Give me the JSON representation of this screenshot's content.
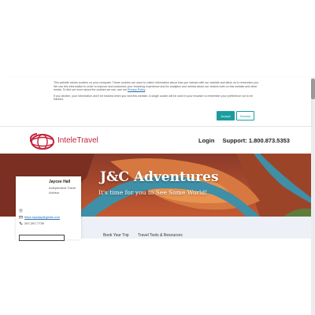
{
  "cookie_banner": {
    "paragraph_1": "This website stores cookies on your computer. These cookies are used to collect information about how you interact with our website and allow us to remember you. We use this information in order to improve and customize your browsing experience and for analytics and metrics about our visitors both on this website and other media. To find out more about the cookies we use, see our",
    "privacy_link": "Privacy Policy",
    "paragraph_2": "If you decline, your information won't be tracked when you visit this website. A single cookie will be used in your browser to remember your preference not to be tracked.",
    "accept_label": "Accept",
    "decline_label": "Decline"
  },
  "header": {
    "logo_text": "InteleTravel",
    "login_label": "Login",
    "support_label": "Support: 1.800.873.5353"
  },
  "hero": {
    "title": "J&C Adventures",
    "subtitle": "It's time for you to See Some World!"
  },
  "profile": {
    "name": "Jaycee Hall",
    "role": "Independent Travel Advisor",
    "email": "https.rayejay@gmail.com",
    "phone": "267-267-7739",
    "icons": [
      "location-pin-icon",
      "email-icon",
      "phone-icon"
    ]
  },
  "tabs": [
    {
      "label": "Book Your Trip"
    },
    {
      "label": "Travel Tools & Resources"
    }
  ],
  "colors": {
    "accent_teal": "#1a9d9d",
    "brand_red": "#c4213a",
    "link_blue": "#2a6fb5",
    "tabs_bg": "#eef0f7"
  }
}
